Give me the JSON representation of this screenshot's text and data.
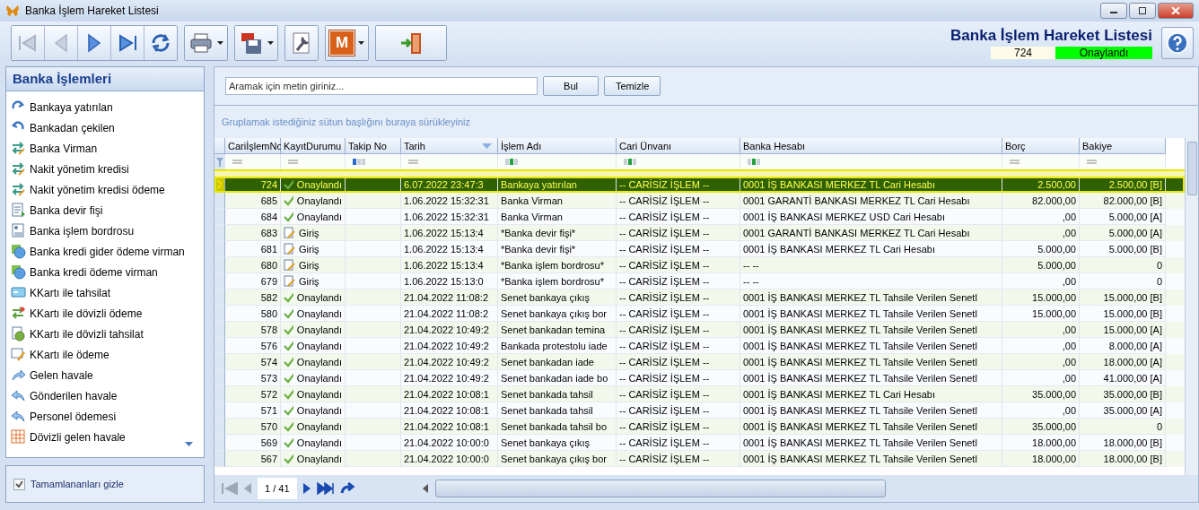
{
  "window": {
    "title": "Banka İşlem Hareket Listesi"
  },
  "toolbar_groups": [
    {
      "buttons": [
        {
          "kind": "first",
          "disabled": true
        },
        {
          "kind": "prev",
          "disabled": true
        },
        {
          "kind": "next",
          "disabled": false
        },
        {
          "kind": "last",
          "disabled": false
        },
        {
          "kind": "refresh",
          "disabled": false
        }
      ]
    },
    {
      "buttons": [
        {
          "kind": "print",
          "dropdown": true
        }
      ]
    },
    {
      "buttons": [
        {
          "kind": "pdf",
          "dropdown": true
        }
      ]
    },
    {
      "buttons": [
        {
          "kind": "tools"
        }
      ]
    },
    {
      "buttons": [
        {
          "kind": "module",
          "label": "M",
          "dropdown": true
        }
      ]
    },
    {
      "buttons": [
        {
          "kind": "exit"
        }
      ]
    }
  ],
  "header": {
    "title": "Banka İşlem Hareket Listesi",
    "record_no": "724",
    "status": {
      "label": "Onaylandı",
      "kind": "approved"
    }
  },
  "sidebar": {
    "title": "Banka İşlemleri",
    "items": [
      {
        "label": "Bankaya yatırılan",
        "kind": "deposit"
      },
      {
        "label": "Bankadan çekilen",
        "kind": "withdraw"
      },
      {
        "label": "Banka Virman",
        "kind": "transfer"
      },
      {
        "label": "Nakit yönetim kredisi",
        "kind": "transfer"
      },
      {
        "label": "Nakit yönetim kredisi ödeme",
        "kind": "transfer"
      },
      {
        "label": "Banka devir fişi",
        "kind": "document"
      },
      {
        "label": "Banka işlem bordrosu",
        "kind": "payroll"
      },
      {
        "label": "Banka kredi gider ödeme virman",
        "kind": "credit"
      },
      {
        "label": "Banka kredi ödeme virman",
        "kind": "credit"
      },
      {
        "label": "KKartı ile tahsilat",
        "kind": "card"
      },
      {
        "label": "KKartı ile dövizli ödeme",
        "kind": "exchange"
      },
      {
        "label": "KKartı ile dövizli tahsilat",
        "kind": "coin"
      },
      {
        "label": "KKartı ile ödeme",
        "kind": "calc"
      },
      {
        "label": "Gelen havale",
        "kind": "incoming"
      },
      {
        "label": "Gönderilen havale",
        "kind": "outgoing"
      },
      {
        "label": "Personel ödemesi",
        "kind": "outgoing"
      },
      {
        "label": "Dövizli gelen havale",
        "kind": "grid"
      }
    ],
    "hide_completed": {
      "label": "Tamamlananları gizle",
      "checked": true
    }
  },
  "search": {
    "placeholder": "Aramak için metin giriniz...",
    "buttons": [
      "Bul",
      "Temizle"
    ]
  },
  "group_hint": "Gruplamak istediğiniz sütun başlığını buraya sürükleyiniz",
  "table": {
    "columns": [
      {
        "label": "CariİşlemNo",
        "sorted": false
      },
      {
        "label": "KayıtDurumu",
        "sorted": false
      },
      {
        "label": "Takip No",
        "sorted": false
      },
      {
        "label": "Tarih",
        "sorted": true
      },
      {
        "label": "İşlem Adı",
        "sorted": false
      },
      {
        "label": "Cari Ünvanı",
        "sorted": false
      },
      {
        "label": "Banka Hesabı",
        "sorted": false
      },
      {
        "label": "Borç",
        "sorted": false
      },
      {
        "label": "Bakiye",
        "sorted": false
      }
    ],
    "rows": [
      {
        "selected": true,
        "no": "724",
        "status": {
          "kind": "approved",
          "label": "Onaylandı"
        },
        "date": "6.07.2022 23:47:3",
        "operation": "Bankaya yatırılan",
        "account_holder": "-- CARİSİZ İŞLEM --",
        "bank_account": "0001 İŞ BANKASI MERKEZ TL Cari Hesabı",
        "debit": "2.500,00",
        "balance": "2.500,00 [B]"
      },
      {
        "selected": false,
        "no": "685",
        "status": {
          "kind": "approved",
          "label": "Onaylandı"
        },
        "date": "1.06.2022 15:32:31",
        "operation": "Banka Virman",
        "account_holder": "-- CARİSİZ İŞLEM --",
        "bank_account": "0001 GARANTİ BANKASI MERKEZ TL Cari Hesabı",
        "debit": "82.000,00",
        "balance": "82.000,00 [B]"
      },
      {
        "selected": false,
        "no": "684",
        "status": {
          "kind": "approved",
          "label": "Onaylandı"
        },
        "date": "1.06.2022 15:32:31",
        "operation": "Banka Virman",
        "account_holder": "-- CARİSİZ İŞLEM --",
        "bank_account": "0001 İŞ BANKASI MERKEZ USD Cari Hesabı",
        "debit": ",00",
        "balance": "5.000,00 [A]"
      },
      {
        "selected": false,
        "no": "683",
        "status": {
          "kind": "entry",
          "label": "Giriş"
        },
        "date": "1.06.2022 15:13:4",
        "operation": "*Banka devir fişi*",
        "account_holder": "-- CARİSİZ İŞLEM --",
        "bank_account": "0001 GARANTİ BANKASI MERKEZ TL Cari Hesabı",
        "debit": ",00",
        "balance": "5.000,00 [A]"
      },
      {
        "selected": false,
        "no": "681",
        "status": {
          "kind": "entry",
          "label": "Giriş"
        },
        "date": "1.06.2022 15:13:4",
        "operation": "*Banka devir fişi*",
        "account_holder": "-- CARİSİZ İŞLEM --",
        "bank_account": "0001 İŞ BANKASI MERKEZ TL Cari Hesabı",
        "debit": "5.000,00",
        "balance": "5.000,00 [B]"
      },
      {
        "selected": false,
        "no": "680",
        "status": {
          "kind": "entry",
          "label": "Giriş"
        },
        "date": "1.06.2022 15:13:4",
        "operation": "*Banka işlem bordrosu*",
        "account_holder": "-- CARİSİZ İŞLEM --",
        "bank_account": "-- --",
        "debit": "5.000,00",
        "balance": "0"
      },
      {
        "selected": false,
        "no": "679",
        "status": {
          "kind": "entry",
          "label": "Giriş"
        },
        "date": "1.06.2022 15:13:0",
        "operation": "*Banka işlem bordrosu*",
        "account_holder": "-- CARİSİZ İŞLEM --",
        "bank_account": "-- --",
        "debit": ",00",
        "balance": "0"
      },
      {
        "selected": false,
        "no": "582",
        "status": {
          "kind": "approved",
          "label": "Onaylandı"
        },
        "date": "21.04.2022 11:08:2",
        "operation": "Senet bankaya çıkış",
        "account_holder": "-- CARİSİZ İŞLEM --",
        "bank_account": "0001 İŞ BANKASI MERKEZ TL Tahsile Verilen Senetl",
        "debit": "15.000,00",
        "balance": "15.000,00 [B]"
      },
      {
        "selected": false,
        "no": "580",
        "status": {
          "kind": "approved",
          "label": "Onaylandı"
        },
        "date": "21.04.2022 11:08:2",
        "operation": "Senet bankaya çıkış bor",
        "account_holder": "-- CARİSİZ İŞLEM --",
        "bank_account": "0001 İŞ BANKASI MERKEZ TL Tahsile Verilen Senetl",
        "debit": "15.000,00",
        "balance": "15.000,00 [B]"
      },
      {
        "selected": false,
        "no": "578",
        "status": {
          "kind": "approved",
          "label": "Onaylandı"
        },
        "date": "21.04.2022 10:49:2",
        "operation": "Senet bankadan temina",
        "account_holder": "-- CARİSİZ İŞLEM --",
        "bank_account": "0001 İŞ BANKASI MERKEZ TL Tahsile Verilen Senetl",
        "debit": ",00",
        "balance": "15.000,00 [A]"
      },
      {
        "selected": false,
        "no": "576",
        "status": {
          "kind": "approved",
          "label": "Onaylandı"
        },
        "date": "21.04.2022 10:49:2",
        "operation": "Bankada protestolu iade",
        "account_holder": "-- CARİSİZ İŞLEM --",
        "bank_account": "0001 İŞ BANKASI MERKEZ TL Tahsile Verilen Senetl",
        "debit": ",00",
        "balance": "8.000,00 [A]"
      },
      {
        "selected": false,
        "no": "574",
        "status": {
          "kind": "approved",
          "label": "Onaylandı"
        },
        "date": "21.04.2022 10:49:2",
        "operation": "Senet bankadan iade",
        "account_holder": "-- CARİSİZ İŞLEM --",
        "bank_account": "0001 İŞ BANKASI MERKEZ TL Tahsile Verilen Senetl",
        "debit": ",00",
        "balance": "18.000,00 [A]"
      },
      {
        "selected": false,
        "no": "573",
        "status": {
          "kind": "approved",
          "label": "Onaylandı"
        },
        "date": "21.04.2022 10:49:2",
        "operation": "Senet bankadan iade bo",
        "account_holder": "-- CARİSİZ İŞLEM --",
        "bank_account": "0001 İŞ BANKASI MERKEZ TL Tahsile Verilen Senetl",
        "debit": ",00",
        "balance": "41.000,00 [A]"
      },
      {
        "selected": false,
        "no": "572",
        "status": {
          "kind": "approved",
          "label": "Onaylandı"
        },
        "date": "21.04.2022 10:08:1",
        "operation": "Senet bankada tahsil",
        "account_holder": "-- CARİSİZ İŞLEM --",
        "bank_account": "0001 İŞ BANKASI MERKEZ TL Cari Hesabı",
        "debit": "35.000,00",
        "balance": "35.000,00 [B]"
      },
      {
        "selected": false,
        "no": "571",
        "status": {
          "kind": "approved",
          "label": "Onaylandı"
        },
        "date": "21.04.2022 10:08:1",
        "operation": "Senet bankada tahsil",
        "account_holder": "-- CARİSİZ İŞLEM --",
        "bank_account": "0001 İŞ BANKASI MERKEZ TL Tahsile Verilen Senetl",
        "debit": ",00",
        "balance": "35.000,00 [A]"
      },
      {
        "selected": false,
        "no": "570",
        "status": {
          "kind": "approved",
          "label": "Onaylandı"
        },
        "date": "21.04.2022 10:08:1",
        "operation": "Senet bankada tahsil bo",
        "account_holder": "-- CARİSİZ İŞLEM --",
        "bank_account": "0001 İŞ BANKASI MERKEZ TL Tahsile Verilen Senetl",
        "debit": "35.000,00",
        "balance": "0"
      },
      {
        "selected": false,
        "no": "569",
        "status": {
          "kind": "approved",
          "label": "Onaylandı"
        },
        "date": "21.04.2022 10:00:0",
        "operation": "Senet bankaya çıkış",
        "account_holder": "-- CARİSİZ İŞLEM --",
        "bank_account": "0001 İŞ BANKASI MERKEZ TL Tahsile Verilen Senetl",
        "debit": "18.000,00",
        "balance": "18.000,00 [B]"
      },
      {
        "selected": false,
        "no": "567",
        "status": {
          "kind": "approved",
          "label": "Onaylandı"
        },
        "date": "21.04.2022 10:00:0",
        "operation": "Senet bankaya çıkış bor",
        "account_holder": "-- CARİSİZ İŞLEM --",
        "bank_account": "0001 İŞ BANKASI MERKEZ TL Tahsile Verilen Senetl",
        "debit": "18.000,00",
        "balance": "18.000,00 [B]"
      }
    ]
  },
  "pager": {
    "page": "1 / 41"
  }
}
